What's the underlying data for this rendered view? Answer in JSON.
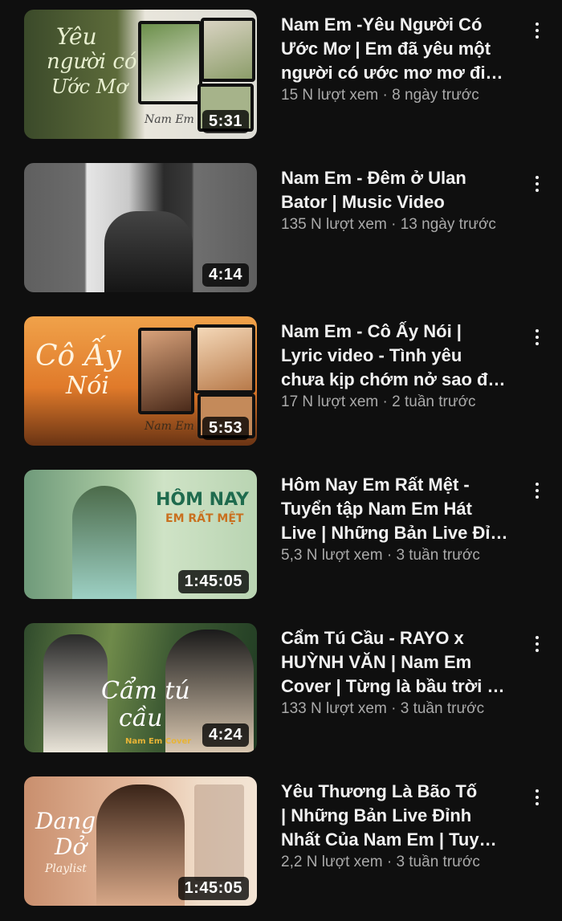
{
  "videos": [
    {
      "title_lines": [
        "Nam Em -Yêu Người Có",
        "Ước Mơ |  Em đã yêu một",
        "người có ước mơ mơ đi…"
      ],
      "views": "15 N lượt xem",
      "age": "8 ngày trước",
      "duration": "5:31",
      "thumb_text": [
        "Yêu",
        "người có",
        "Ước Mơ"
      ],
      "thumb_signature": "Nam Em"
    },
    {
      "title_lines": [
        "Nam Em - Đêm ở Ulan",
        "Bator | Music Video"
      ],
      "views": "135 N lượt xem",
      "age": "13 ngày trước",
      "duration": "4:14"
    },
    {
      "title_lines": [
        "Nam Em - Cô Ấy Nói |",
        "Lyric video - Tình yêu",
        "chưa kịp chớm nở sao đ…"
      ],
      "views": "17 N lượt xem",
      "age": "2 tuần trước",
      "duration": "5:53",
      "thumb_text": [
        "Cô Ấy",
        "Nói"
      ],
      "thumb_signature": "Nam Em"
    },
    {
      "title_lines": [
        "Hôm Nay Em Rất Mệt -",
        "Tuyển tập Nam Em Hát",
        "Live | Những Bản Live Đỉ…"
      ],
      "views": "5,3 N lượt xem",
      "age": "3 tuần trước",
      "duration": "1:45:05",
      "thumb_text": [
        "HÔM NAY",
        "EM RẤT MỆT"
      ]
    },
    {
      "title_lines": [
        "Cẩm Tú Cầu - RAYO x",
        "HUỲNH VĂN | Nam Em",
        "Cover  | Từng là bầu trời …"
      ],
      "views": "133 N lượt xem",
      "age": "3 tuần trước",
      "duration": "4:24",
      "thumb_text": [
        "Cẩm tú",
        "cầu",
        "Nam Em Cover"
      ]
    },
    {
      "title_lines": [
        "Yêu Thương Là Bão Tố",
        "| Những Bản Live Đỉnh",
        "Nhất Của Nam Em | Tuy…"
      ],
      "views": "2,2 N lượt xem",
      "age": "3 tuần trước",
      "duration": "1:45:05",
      "thumb_text": [
        "Dang",
        "Dở",
        "Playlist"
      ]
    }
  ],
  "colors": {
    "background": "#0f0f0f",
    "title": "#f1f1f1",
    "meta": "#aaaaaa"
  },
  "icons": {
    "more": "more-vert-icon"
  }
}
